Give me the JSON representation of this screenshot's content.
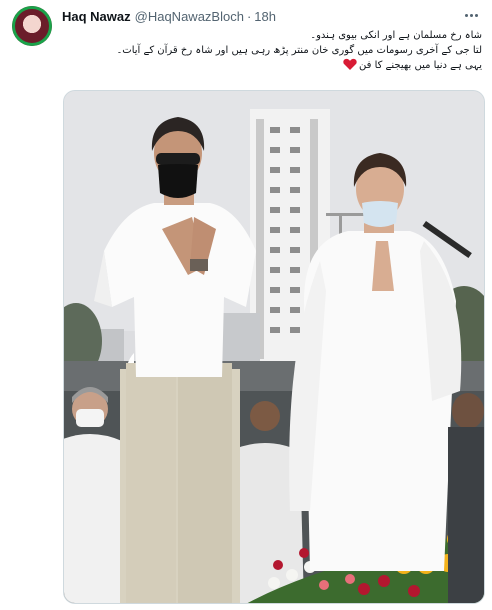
{
  "tweet": {
    "display_name": "Haq Nawaz",
    "handle": "@HaqNawazBloch",
    "separator": "·",
    "time": "18h",
    "lines": [
      "شاہ رخ مسلمان ہے اور انکی بیوی ہندو۔",
      "لتا جی کے آخری رسومات میں گوری خان منتر پڑھ رہی ہیں اور شاہ رخ قرآن کے آیات۔",
      "یہی ہے دنیا میں بھیجنے کا فن"
    ]
  },
  "icons": {
    "more": "more-horizontal-icon",
    "heart": "red-heart-icon",
    "heart_color": "#d81b35"
  },
  "colors": {
    "verified_ring": "#1aa34a",
    "secondary_text": "#536471"
  }
}
